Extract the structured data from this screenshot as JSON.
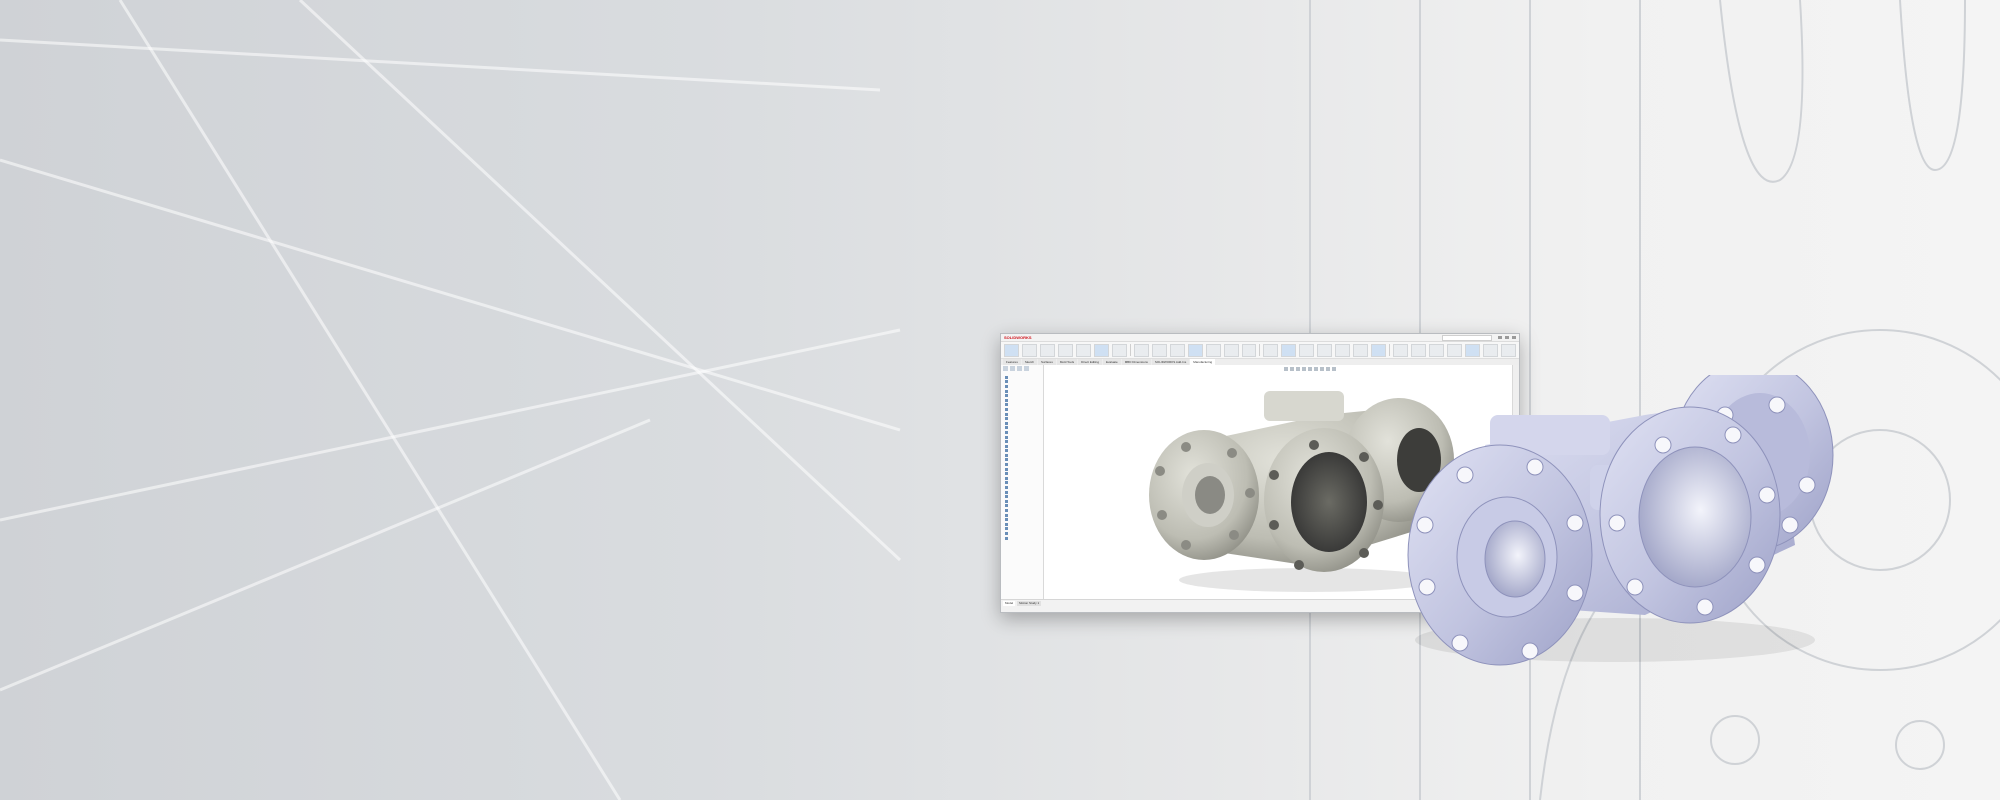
{
  "hero": {
    "background_colors": [
      "#cfd2d6",
      "#f4f4f4"
    ],
    "accent_part_color": "#c3c6e3"
  },
  "cad_window": {
    "brand": "SOLIDWORKS",
    "doc_title": "",
    "ribbon_buttons": 28,
    "command_tabs": [
      {
        "label": "Features"
      },
      {
        "label": "Sketch"
      },
      {
        "label": "Surfaces"
      },
      {
        "label": "Mold Tools"
      },
      {
        "label": "Direct Editing"
      },
      {
        "label": "Evaluate"
      },
      {
        "label": "MBD Dimensions"
      },
      {
        "label": "SOLIDWORKS Add-Ins"
      },
      {
        "label": "Manufacturing",
        "active": true
      }
    ],
    "tree_items": [
      "",
      "",
      "",
      "",
      "",
      "",
      "",
      "",
      "",
      "",
      "",
      "",
      "",
      "",
      "",
      "",
      "",
      "",
      "",
      "",
      "",
      "",
      "",
      "",
      "",
      "",
      "",
      "",
      "",
      "",
      "",
      "",
      "",
      "",
      "",
      ""
    ],
    "model_tabs": [
      {
        "label": "Model",
        "active": true
      },
      {
        "label": "Motion Study 1"
      }
    ],
    "status_text": ""
  },
  "parts": [
    {
      "name": "scanned-valve-body",
      "material": "scan mesh",
      "color": "#cfcfc6"
    },
    {
      "name": "cad-valve-body",
      "material": "cad model",
      "color": "#c3c6e3"
    }
  ]
}
